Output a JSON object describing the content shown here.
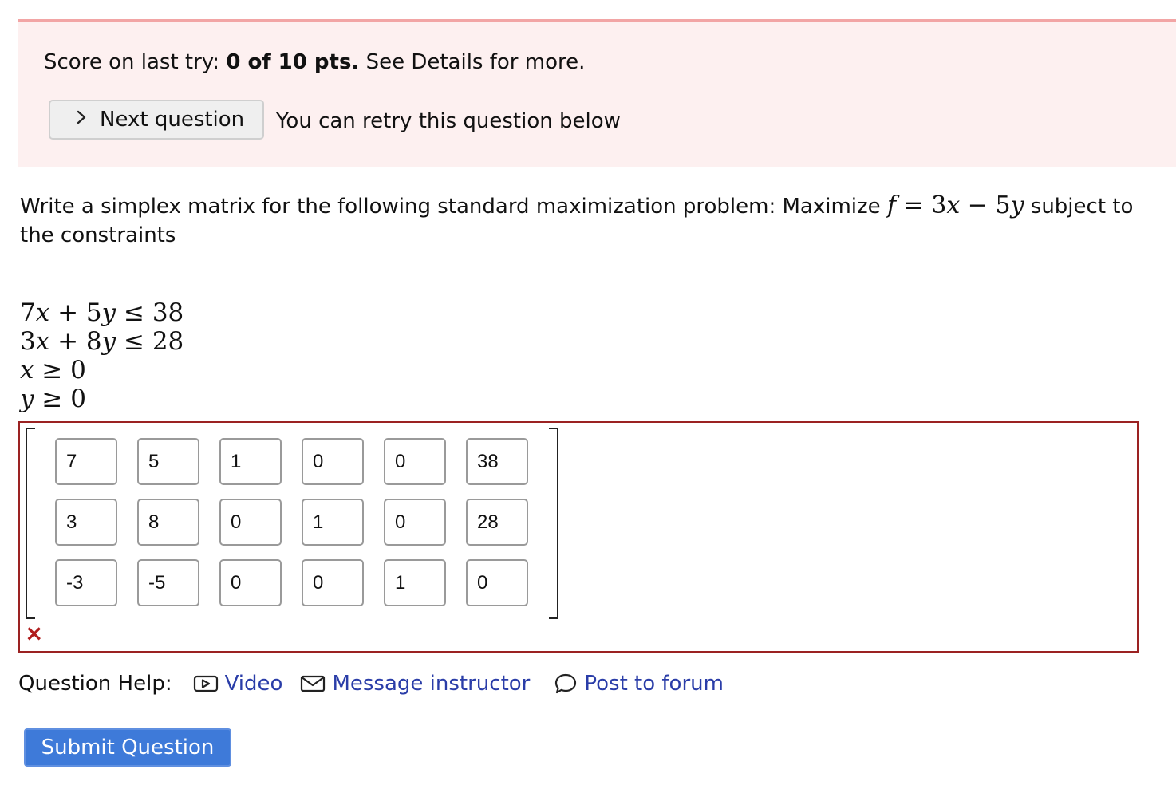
{
  "banner": {
    "score_prefix": "Score on last try:",
    "score_value": "0 of 10 pts.",
    "score_suffix": "See Details for more.",
    "next_label": "Next question",
    "retry_text": "You can retry this question below",
    "color_bg": "#fdf0f0",
    "color_border": "#f2a5a5"
  },
  "question": {
    "prompt_pre": "Write a simplex matrix for the following standard maximization problem: Maximize",
    "objective": {
      "f": "f",
      "eq": " = 3",
      "x": "x",
      "minus": " − 5",
      "y": "y"
    },
    "prompt_post": "subject to the constraints",
    "constraints": [
      {
        "a": "7",
        "x": "x",
        "mid": " + 5",
        "y": "y",
        "rhs": " ≤ 38"
      },
      {
        "a": "3",
        "x": "x",
        "mid": " + 8",
        "y": "y",
        "rhs": " ≤ 28"
      },
      {
        "var": "x",
        "rhs": " ≥ 0"
      },
      {
        "var": "y",
        "rhs": " ≥ 0"
      }
    ]
  },
  "matrix": {
    "rows": [
      [
        "7",
        "5",
        "1",
        "0",
        "0",
        "38"
      ],
      [
        "3",
        "8",
        "0",
        "1",
        "0",
        "28"
      ],
      [
        "-3",
        "-5",
        "0",
        "0",
        "1",
        "0"
      ]
    ],
    "status_icon": "×",
    "status_color": "#b01c1c"
  },
  "help": {
    "label": "Question Help:",
    "video": "Video",
    "message": "Message instructor",
    "forum": "Post to forum",
    "link_color": "#2a3da8"
  },
  "submit_label": "Submit Question",
  "submit_color": "#3e7ad9"
}
